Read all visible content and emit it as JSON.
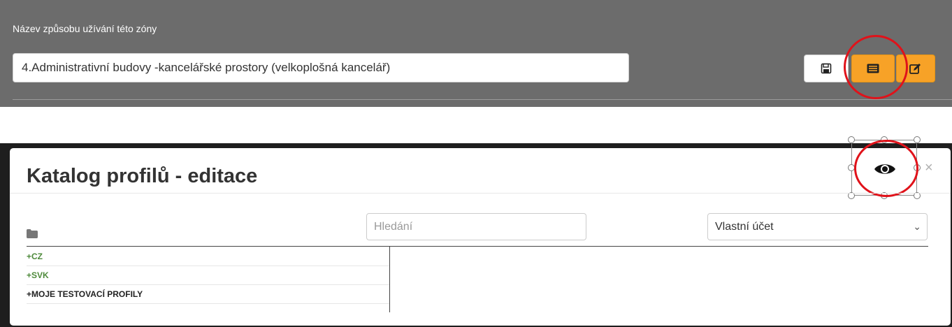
{
  "zone": {
    "label": "Název způsobu užívání této zóny",
    "value": "4.Administrativní budovy -kancelářské prostory (velkoplošná kancelář)",
    "buttons": [
      {
        "name": "save",
        "icon": "floppy-disk-icon"
      },
      {
        "name": "catalog",
        "icon": "list-icon"
      },
      {
        "name": "edit",
        "icon": "pencil-square-icon"
      }
    ]
  },
  "modal": {
    "title": "Katalog profilů - editace",
    "close": "×",
    "eye_icon": "eye-icon",
    "search_placeholder": "Hledání",
    "account_select": "Vlastní účet",
    "tree": [
      {
        "label": "+CZ",
        "color": "#4e8a3b"
      },
      {
        "label": "+SVK",
        "color": "#4e8a3b"
      },
      {
        "label": "+MOJE TESTOVACÍ PROFILY",
        "color": "#222222"
      }
    ]
  },
  "colors": {
    "panel_bg": "#6c6c6c",
    "accent_orange": "#f7a227",
    "highlight_red": "#e0121a"
  }
}
